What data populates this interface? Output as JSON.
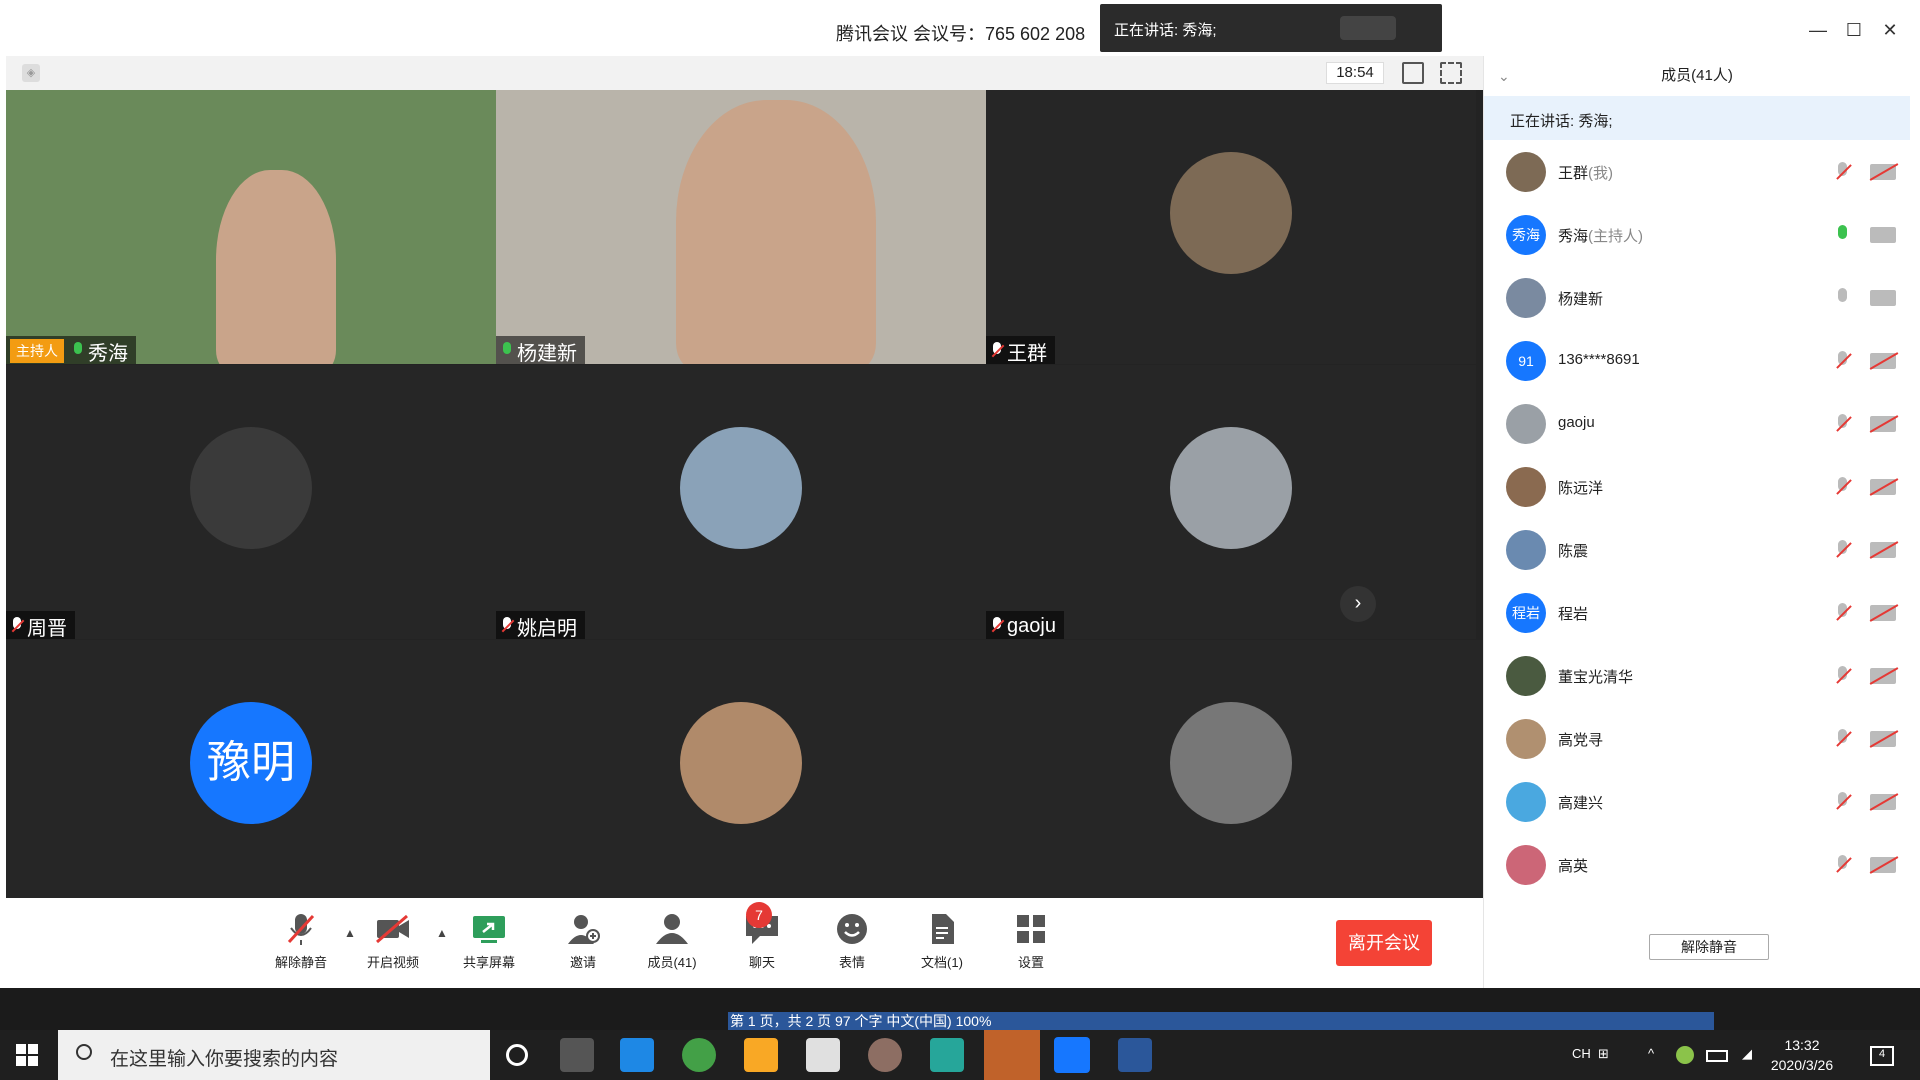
{
  "window": {
    "meeting_title": "腾讯会议 会议号：765 602 208",
    "speaking_banner": "正在讲话: 秀海;",
    "timer": "18:54"
  },
  "tiles": [
    {
      "name": "秀海",
      "host_label": "主持人",
      "mic": "on",
      "type": "video",
      "bg": "#6a8a5a"
    },
    {
      "name": "杨建新",
      "mic": "on",
      "type": "video",
      "bg": "#b9b4aa"
    },
    {
      "name": "王群",
      "mic": "off",
      "type": "avatar",
      "avatar_color": "#7d6a55"
    },
    {
      "name": "周晋",
      "mic": "off",
      "type": "avatar",
      "avatar_color": "#3a3a3a"
    },
    {
      "name": "姚启明",
      "mic": "off",
      "type": "avatar",
      "avatar_color": "#8aa2b8"
    },
    {
      "name": "gaoju",
      "mic": "off",
      "type": "avatar",
      "avatar_color": "#9aa0a6"
    },
    {
      "name": "",
      "mic": "off",
      "type": "text-avatar",
      "avatar_text": "豫明",
      "avatar_color": "#1677ff"
    },
    {
      "name": "",
      "mic": "off",
      "type": "avatar",
      "avatar_color": "#b08a6a"
    },
    {
      "name": "",
      "mic": "off",
      "type": "avatar",
      "avatar_color": "#777777"
    }
  ],
  "toolbar": {
    "unmute": "解除静音",
    "start_video": "开启视频",
    "share_screen": "共享屏幕",
    "invite": "邀请",
    "members": "成员(41)",
    "chat": "聊天",
    "chat_badge": "7",
    "emoji": "表情",
    "docs": "文档(1)",
    "settings": "设置",
    "leave": "离开会议"
  },
  "panel": {
    "title": "成员(41人)",
    "speaking": "正在讲话: 秀海;",
    "unmute_all": "解除静音",
    "members": [
      {
        "name": "王群",
        "role": "(我)",
        "mic": "off",
        "cam": "off",
        "avatar_text": "",
        "avatar_color": "#7d6a55"
      },
      {
        "name": "秀海",
        "role": "(主持人)",
        "mic": "on",
        "cam": "on",
        "avatar_text": "秀海",
        "avatar_color": "#1677ff"
      },
      {
        "name": "杨建新",
        "role": "",
        "mic": "idle",
        "cam": "on",
        "avatar_text": "",
        "avatar_color": "#7a8aa0"
      },
      {
        "name": "136****8691",
        "role": "",
        "mic": "off",
        "cam": "off",
        "avatar_text": "91",
        "avatar_color": "#1677ff"
      },
      {
        "name": "gaoju",
        "role": "",
        "mic": "off",
        "cam": "off",
        "avatar_text": "",
        "avatar_color": "#9aa0a6"
      },
      {
        "name": "陈远洋",
        "role": "",
        "mic": "off",
        "cam": "off",
        "avatar_text": "",
        "avatar_color": "#8a6a50"
      },
      {
        "name": "陈震",
        "role": "",
        "mic": "off",
        "cam": "off",
        "avatar_text": "",
        "avatar_color": "#6a8ab0"
      },
      {
        "name": "程岩",
        "role": "",
        "mic": "off",
        "cam": "off",
        "avatar_text": "程岩",
        "avatar_color": "#1677ff"
      },
      {
        "name": "董宝光清华",
        "role": "",
        "mic": "off",
        "cam": "off",
        "avatar_text": "",
        "avatar_color": "#4a5a40"
      },
      {
        "name": "高党寻",
        "role": "",
        "mic": "off",
        "cam": "off",
        "avatar_text": "",
        "avatar_color": "#b09070"
      },
      {
        "name": "高建兴",
        "role": "",
        "mic": "off",
        "cam": "off",
        "avatar_text": "",
        "avatar_color": "#4aa8e0"
      },
      {
        "name": "高英",
        "role": "",
        "mic": "off",
        "cam": "off",
        "avatar_text": "",
        "avatar_color": "#cc6677"
      }
    ]
  },
  "word_status": "第 1 页，共 2 页    97 个字    中文(中国)                                                                                   100%",
  "taskbar": {
    "search_placeholder": "在这里输入你要搜索的内容",
    "lang": "CH",
    "time": "13:32",
    "date": "2020/3/26",
    "notif_count": "4"
  }
}
